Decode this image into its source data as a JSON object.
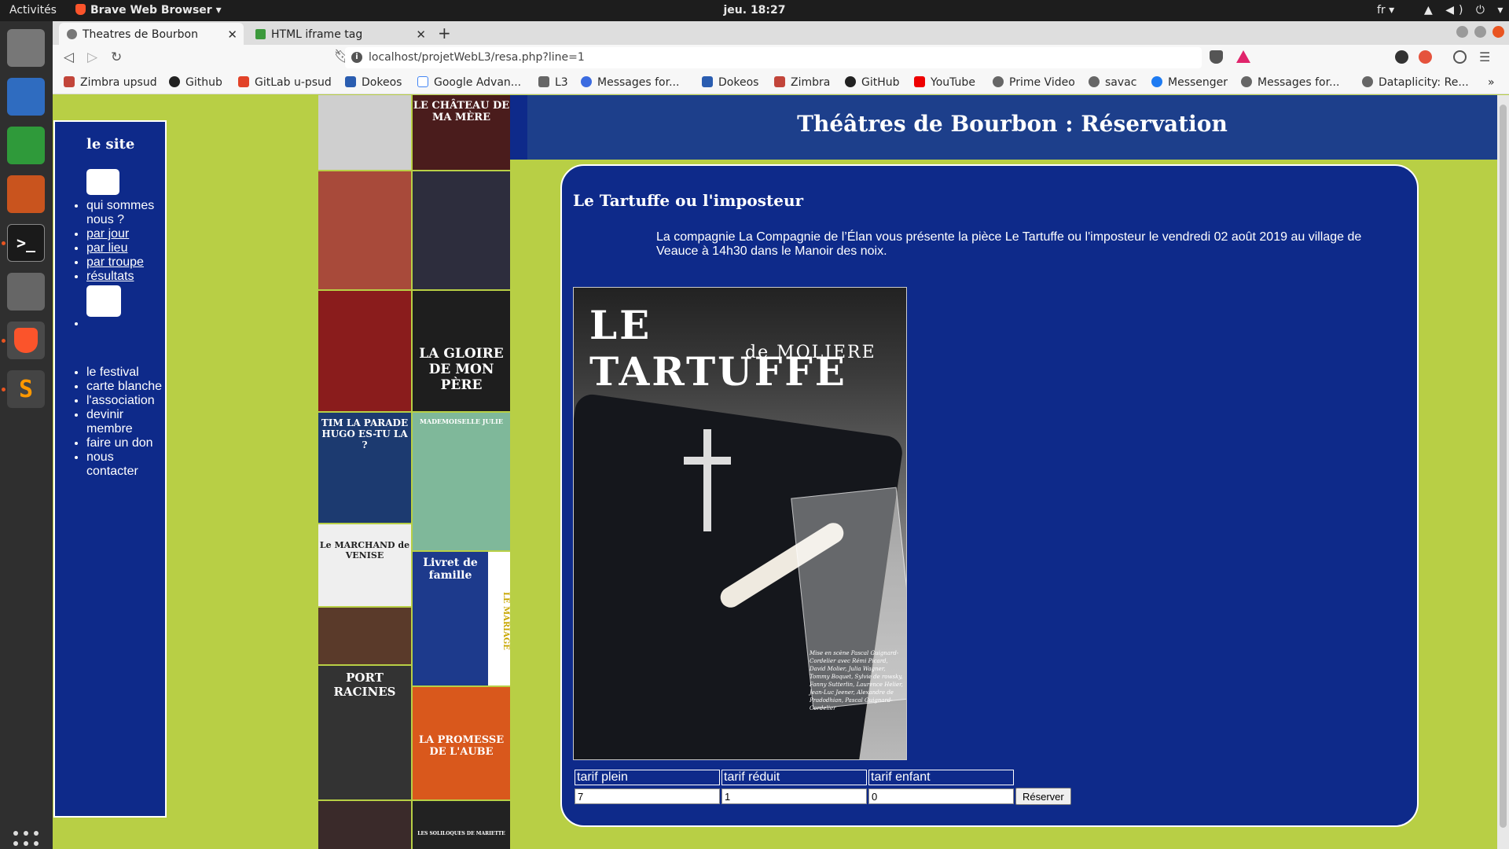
{
  "system": {
    "activities": "Activités",
    "app_name": "Brave Web Browser ▾",
    "clock": "jeu. 18:27",
    "lang": "fr ▾",
    "tray": "▲ ◀) ⏻ ▾"
  },
  "browser": {
    "tabs": [
      {
        "label": "Theatres de Bourbon",
        "active": true
      },
      {
        "label": "HTML iframe tag",
        "active": false
      }
    ],
    "url": "localhost/projetWebL3/resa.php?line=1",
    "bookmarks": [
      "Zimbra upsud",
      "Github",
      "GitLab u-psud",
      "Dokeos",
      "Google Advan...",
      "L3",
      "Messages for...",
      "Dokeos",
      "Zimbra",
      "GitHub",
      "YouTube",
      "Prime Video",
      "savac",
      "Messenger",
      "Messages for...",
      "Dataplicity: Re..."
    ],
    "bookmarks_overflow": "»"
  },
  "sidebar": {
    "title": "le site",
    "menu1": [
      "qui sommes nous ?",
      "par jour",
      "par lieu",
      "par troupe",
      "résultats"
    ],
    "menu3": [
      "le festival",
      "carte blanche",
      "l'association",
      "devinir membre",
      "faire un don",
      "nous contacter"
    ]
  },
  "posters": [
    "LE CHÂTEAU DE MA MÈRE",
    "LA GLOIRE DE MON PÈRE",
    "TIM LA PARADE HUGO ES-TU LA ?",
    "MADEMOISELLE JULIE",
    "Le MARCHAND de VENISE",
    "Livret de famille",
    "LE MARIAGE",
    "PORT RACINES",
    "LA PROMESSE DE L'AUBE",
    "LES SOLILOQUES DE MARIETTE"
  ],
  "page": {
    "title": "Théâtres de Bourbon : Réservation",
    "play_title": "Le Tartuffe ou l'imposteur",
    "description": "La compagnie La Compagnie de l’Élan vous présente la pièce Le Tartuffe ou l'imposteur le vendredi 02 août 2019 au village de Veauce à 14h30 dans le Manoir des noix.",
    "poster": {
      "title": "LE TARTUFFE",
      "subtitle": "de MOLIERE",
      "credits": "Mise en scène Pascal Guignard-Cordelier avec Rémi Picard, David Molier, Julia Wagner, Tommy Boquet, Sylvie de rowsky, Fanny Sutterlin, Laurence Helier, Jean-Luc Jeener, Alexandre de Pradodhian, Pascal Guignard-Cordelier"
    },
    "tarifs": {
      "headers": [
        "tarif plein",
        "tarif réduit",
        "tarif enfant"
      ],
      "values": [
        "7",
        "1",
        "0"
      ],
      "button": "Réserver"
    }
  }
}
